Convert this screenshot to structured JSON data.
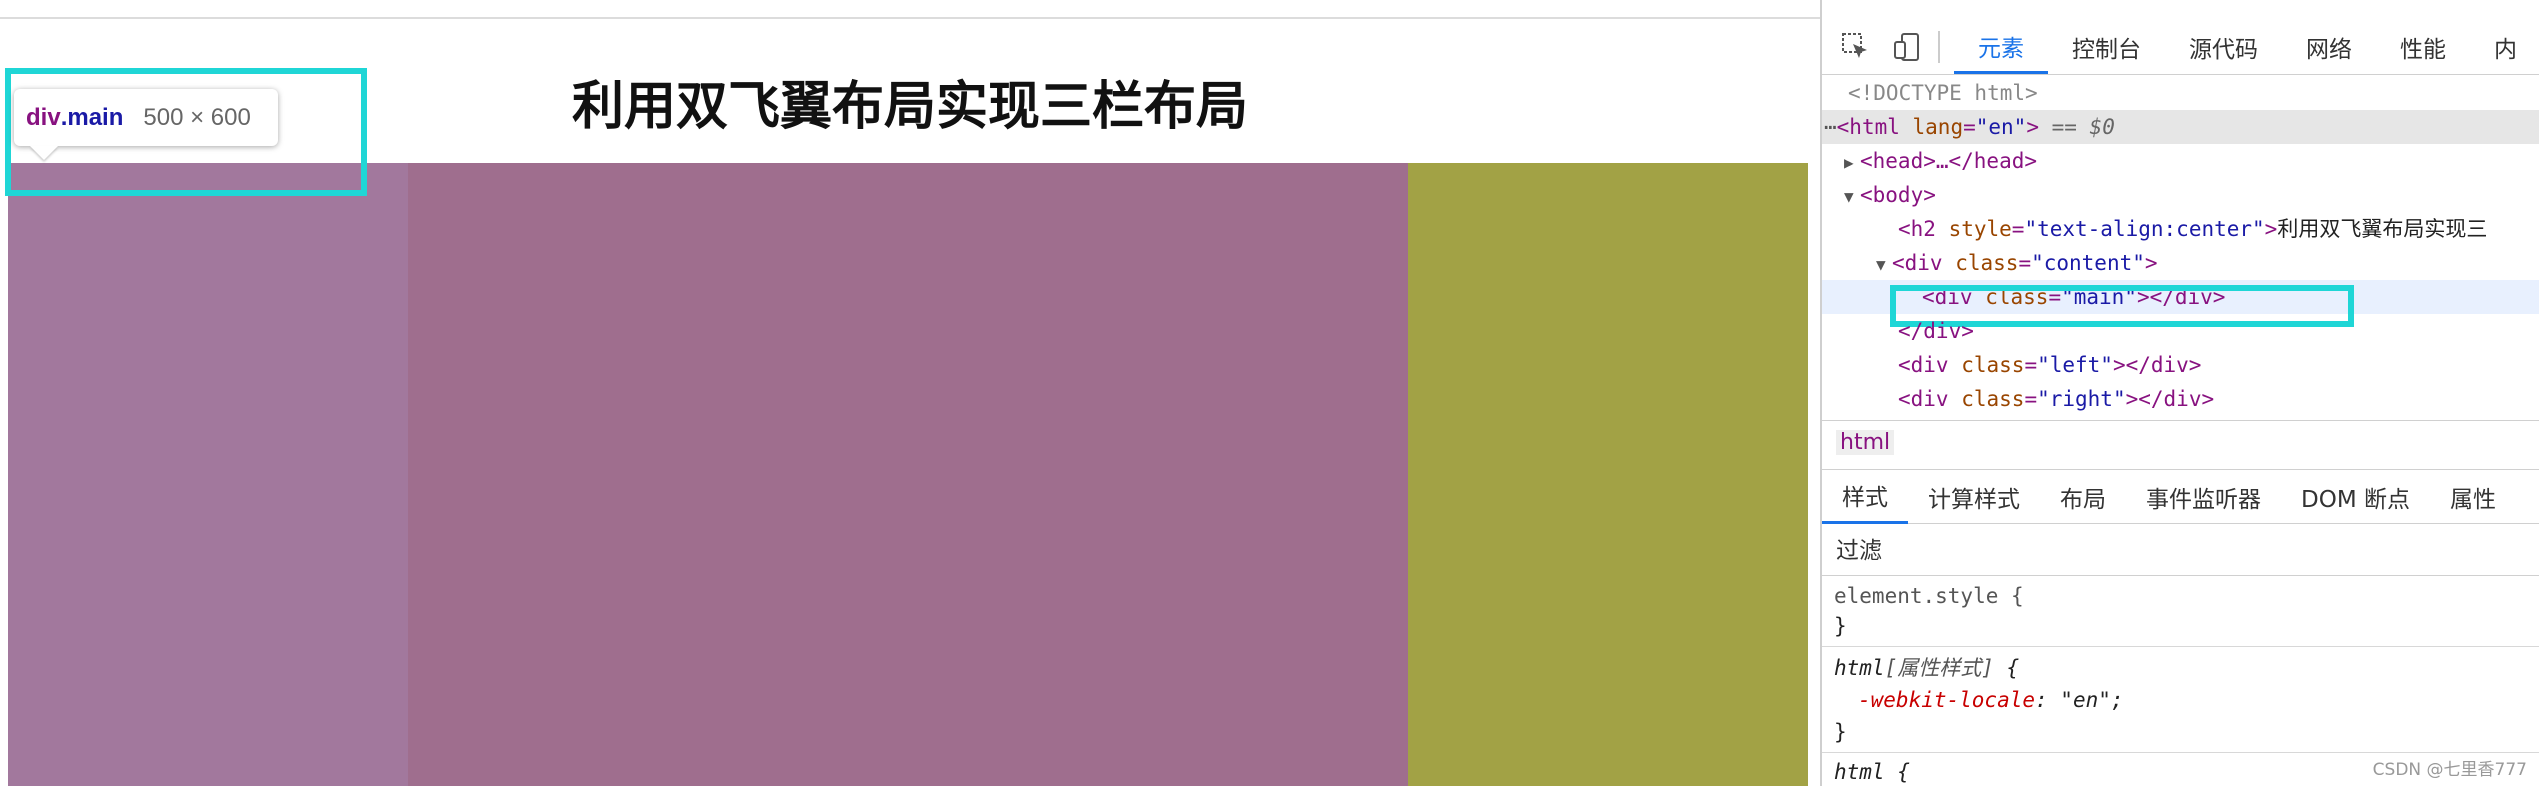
{
  "page": {
    "heading": "利用双飞翼布局实现三栏布局"
  },
  "tooltip": {
    "tag": "div",
    "class": ".main",
    "size": "500 × 600"
  },
  "colors": {
    "main": "#9f6e8e",
    "main_overlay": "#a2789d",
    "right": "#a2a245",
    "highlight": "#1fd6d6",
    "active_tab": "#1a73e8"
  },
  "devtools": {
    "tabs": [
      "元素",
      "控制台",
      "源代码",
      "网络",
      "性能",
      "内"
    ],
    "icons": [
      "inspect-cursor-icon",
      "device-toggle-icon"
    ],
    "tree": {
      "doctype": "<!DOCTYPE html>",
      "html_open": "<html",
      "html_attr": " lang",
      "html_eq": "=",
      "html_val": "\"en\"",
      "html_close": ">",
      "html_marker": " == $0",
      "head": "<head>…</head>",
      "body": "<body>",
      "h2_tag": "<h2",
      "h2_attr": " style",
      "h2_val": "\"text-align:center\"",
      "h2_text": "利用双飞翼布局实现三",
      "content_tag": "<div",
      "content_attr": " class",
      "content_val": "\"content\"",
      "main_tag": "<div",
      "main_attr": " class",
      "main_val": "\"main\"",
      "main_end": "></div>",
      "div_close": "</div>",
      "left_tag": "<div",
      "left_attr": " class",
      "left_val": "\"left\"",
      "left_end": "></div>",
      "right_tag": "<div",
      "right_attr": " class",
      "right_val": "\"right\"",
      "right_end": "></div>"
    },
    "breadcrumb": "html",
    "subtabs": [
      "样式",
      "计算样式",
      "布局",
      "事件监听器",
      "DOM 断点",
      "属性"
    ],
    "filter_placeholder": "过滤",
    "styles": {
      "element_style": "element.style {",
      "close_brace": "}",
      "html_attr_sel": "html",
      "html_attr_label": "[属性样式]",
      "open_brace": " {",
      "prop": "-webkit-locale",
      "prop_val": ": \"en\";",
      "html_rule": "html {"
    },
    "watermark": "CSDN @七里香777"
  }
}
